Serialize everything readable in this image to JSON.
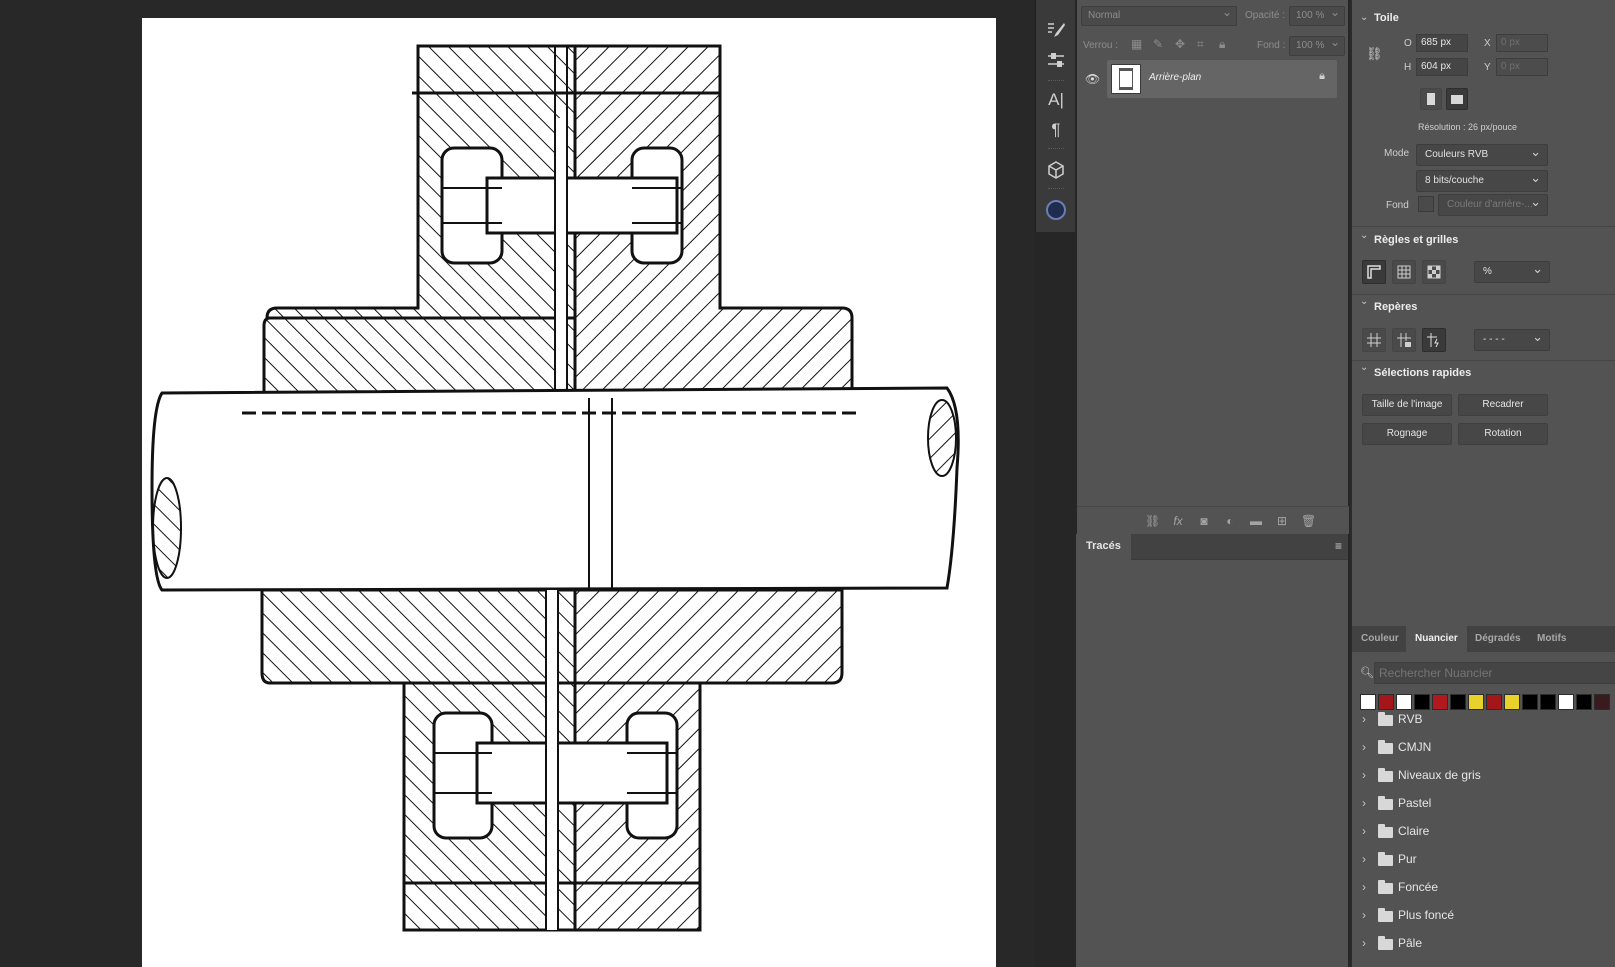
{
  "layers_panel": {
    "blend_mode": "Normal",
    "opacity_label": "Opacité :",
    "opacity_value": "100 %",
    "lock_label": "Verrou :",
    "fill_label": "Fond :",
    "fill_value": "100 %",
    "layer_name": "Arrière-plan"
  },
  "paths_panel": {
    "tab_label": "Tracés"
  },
  "properties": {
    "canvas_title": "Toile",
    "width_label": "O",
    "width_value": "685 px",
    "height_label": "H",
    "height_value": "604 px",
    "x_label": "X",
    "x_value": "0 px",
    "y_label": "Y",
    "y_value": "0 px",
    "resolution": "Résolution : 26 px/pouce",
    "mode_label": "Mode",
    "mode_value": "Couleurs RVB",
    "bits_value": "8 bits/couche",
    "fond_label": "Fond",
    "fond_value": "Couleur d'arrière-...",
    "rulers_title": "Règles et grilles",
    "rulers_unit": "%",
    "guides_title": "Repères",
    "guides_style": "- - - -",
    "quick_title": "Sélections rapides",
    "quick_buttons": [
      "Taille de l'image",
      "Recadrer",
      "Rognage",
      "Rotation"
    ]
  },
  "swatches": {
    "tabs": [
      "Couleur",
      "Nuancier",
      "Dégradés",
      "Motifs"
    ],
    "active_tab": "Nuancier",
    "search_placeholder": "Rechercher Nuancier",
    "colors": [
      "#ffffff",
      "#a3161a",
      "#ffffff",
      "#000000",
      "#b0191e",
      "#000000",
      "#e8d12a",
      "#a3161a",
      "#e8d12a",
      "#000000",
      "#000000",
      "#ffffff",
      "#000000",
      "#3a1a1f"
    ],
    "folders": [
      "RVB",
      "CMJN",
      "Niveaux de gris",
      "Pastel",
      "Claire",
      "Pur",
      "Foncée",
      "Plus foncé",
      "Pâle"
    ]
  }
}
